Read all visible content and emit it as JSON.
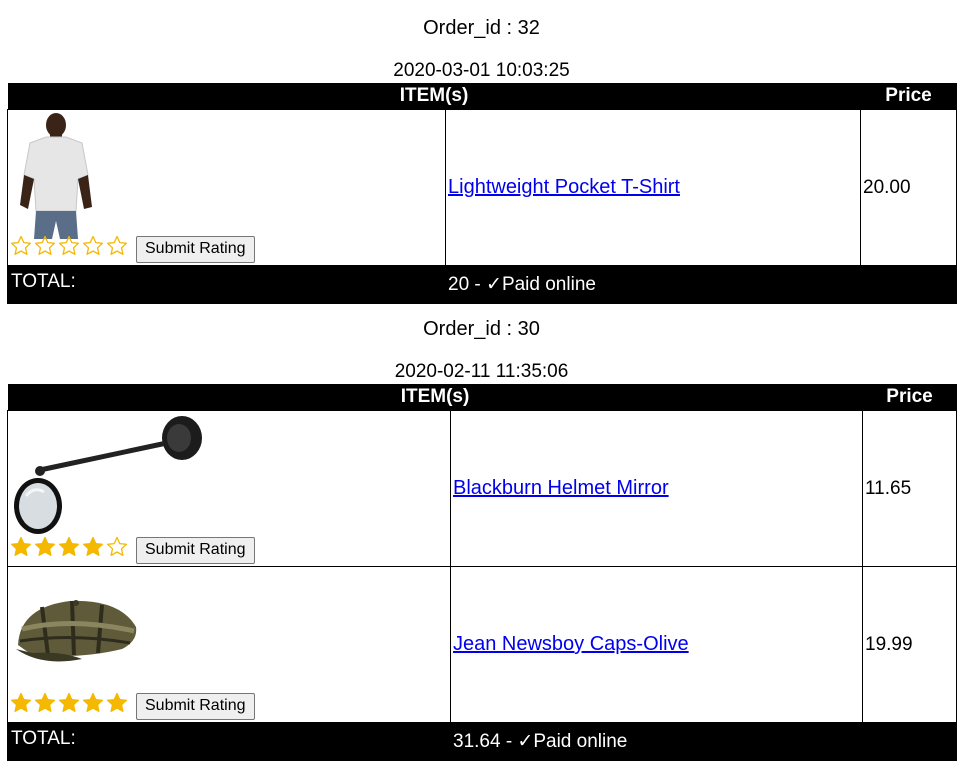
{
  "orders": [
    {
      "order_id_text": "Order_id : 32",
      "date": "2020-03-01 10:03:25",
      "headers": {
        "items": "ITEM(s)",
        "price": "Price"
      },
      "items": [
        {
          "name": "Lightweight Pocket T-Shirt",
          "price": "20.00",
          "rating": 0,
          "rating_max": 5,
          "submit_label": "Submit Rating",
          "image": "t-shirt-man-photo"
        }
      ],
      "total_label": "TOTAL:",
      "total_value": "20 - ✓Paid online"
    },
    {
      "order_id_text": "Order_id : 30",
      "date": "2020-02-11 11:35:06",
      "headers": {
        "items": "ITEM(s)",
        "price": "Price"
      },
      "items": [
        {
          "name": "Blackburn Helmet Mirror",
          "price": "11.65",
          "rating": 4,
          "rating_max": 5,
          "submit_label": "Submit Rating",
          "image": "helmet-mirror-photo"
        },
        {
          "name": "Jean Newsboy Caps-Olive",
          "price": "19.99",
          "rating": 5,
          "rating_max": 5,
          "submit_label": "Submit Rating",
          "image": "newsboy-cap-photo"
        }
      ],
      "total_label": "TOTAL:",
      "total_value": "31.64 - ✓Paid online"
    }
  ],
  "colors": {
    "star_filled": "#f5b800",
    "star_empty_stroke": "#f5b800",
    "link": "#0000ee",
    "header_bg": "#000000"
  }
}
